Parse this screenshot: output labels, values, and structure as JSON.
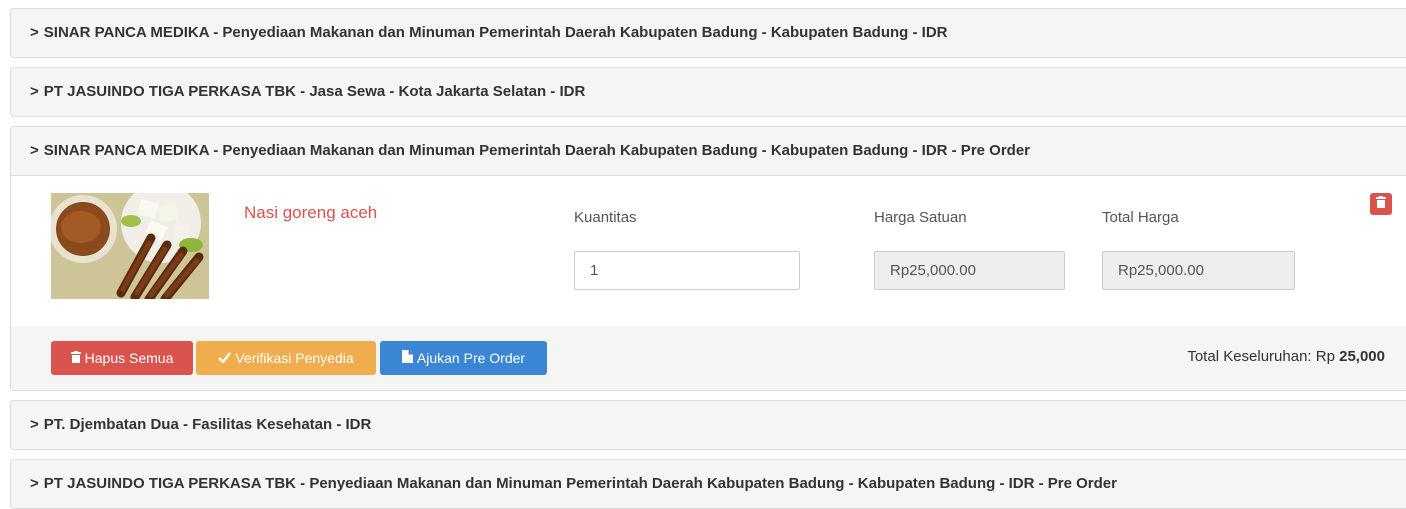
{
  "groups": [
    {
      "title": "SINAR PANCA MEDIKA - Penyediaan Makanan dan Minuman Pemerintah Daerah Kabupaten Badung - Kabupaten Badung - IDR"
    },
    {
      "title": "PT JASUINDO TIGA PERKASA TBK - Jasa Sewa - Kota Jakarta Selatan - IDR"
    },
    {
      "title": "SINAR PANCA MEDIKA - Penyediaan Makanan dan Minuman Pemerintah Daerah Kabupaten Badung - Kabupaten Badung - IDR - Pre Order"
    },
    {
      "title": "PT. Djembatan Dua - Fasilitas Kesehatan - IDR"
    },
    {
      "title": "PT JASUINDO TIGA PERKASA TBK - Penyediaan Makanan dan Minuman Pemerintah Daerah Kabupaten Badung - Kabupaten Badung - IDR - Pre Order"
    }
  ],
  "caret": ">",
  "item": {
    "name": "Nasi goreng aceh",
    "qty_label": "Kuantitas",
    "qty_value": "1",
    "unit_price_label": "Harga Satuan",
    "unit_price_value": "Rp25,000.00",
    "total_label": "Total Harga",
    "total_value": "Rp25,000.00"
  },
  "footer": {
    "delete_all": "Hapus Semua",
    "verify": "Verifikasi Penyedia",
    "submit": "Ajukan Pre Order",
    "grand_total_label": "Total Keseluruhan: Rp",
    "grand_total_value": "25,000"
  },
  "colors": {
    "danger": "#d9534f",
    "warning": "#f0ad4e",
    "primary": "#3a86d4"
  }
}
